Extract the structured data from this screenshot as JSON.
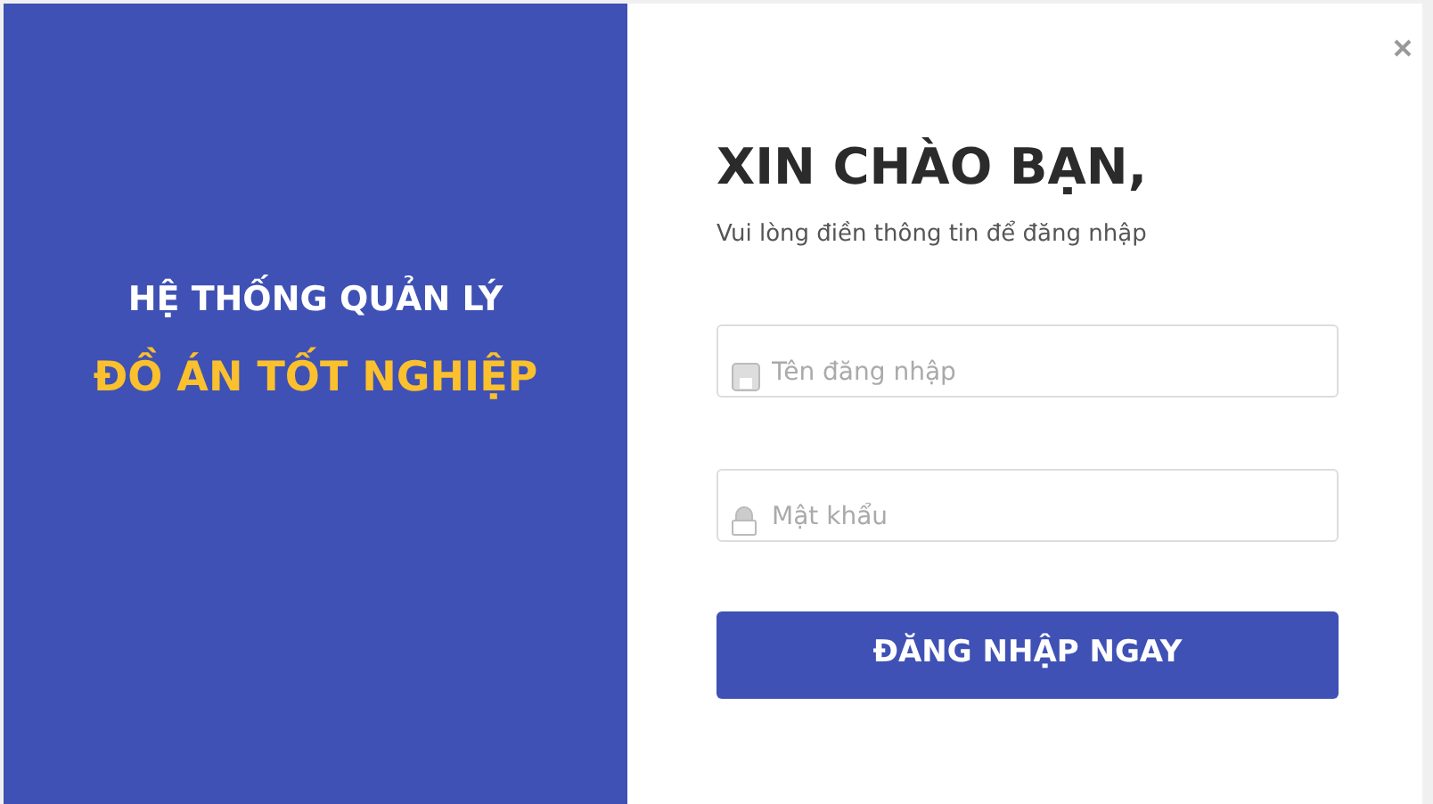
{
  "brand_panel": {
    "line_1": "HỆ THỐNG QUẢN LÝ",
    "line_2": "ĐỒ ÁN TỐT NGHIỆP"
  },
  "login": {
    "title": "XIN CHÀO BẠN,",
    "subtitle": "Vui lòng điền thông tin để đăng nhập",
    "fields": [
      {
        "kind": "username",
        "placeholder": "Tên đăng nhập"
      },
      {
        "kind": "password",
        "placeholder": "Mật khẩu"
      }
    ],
    "submit": "ĐĂNG NHẬP NGAY"
  }
}
